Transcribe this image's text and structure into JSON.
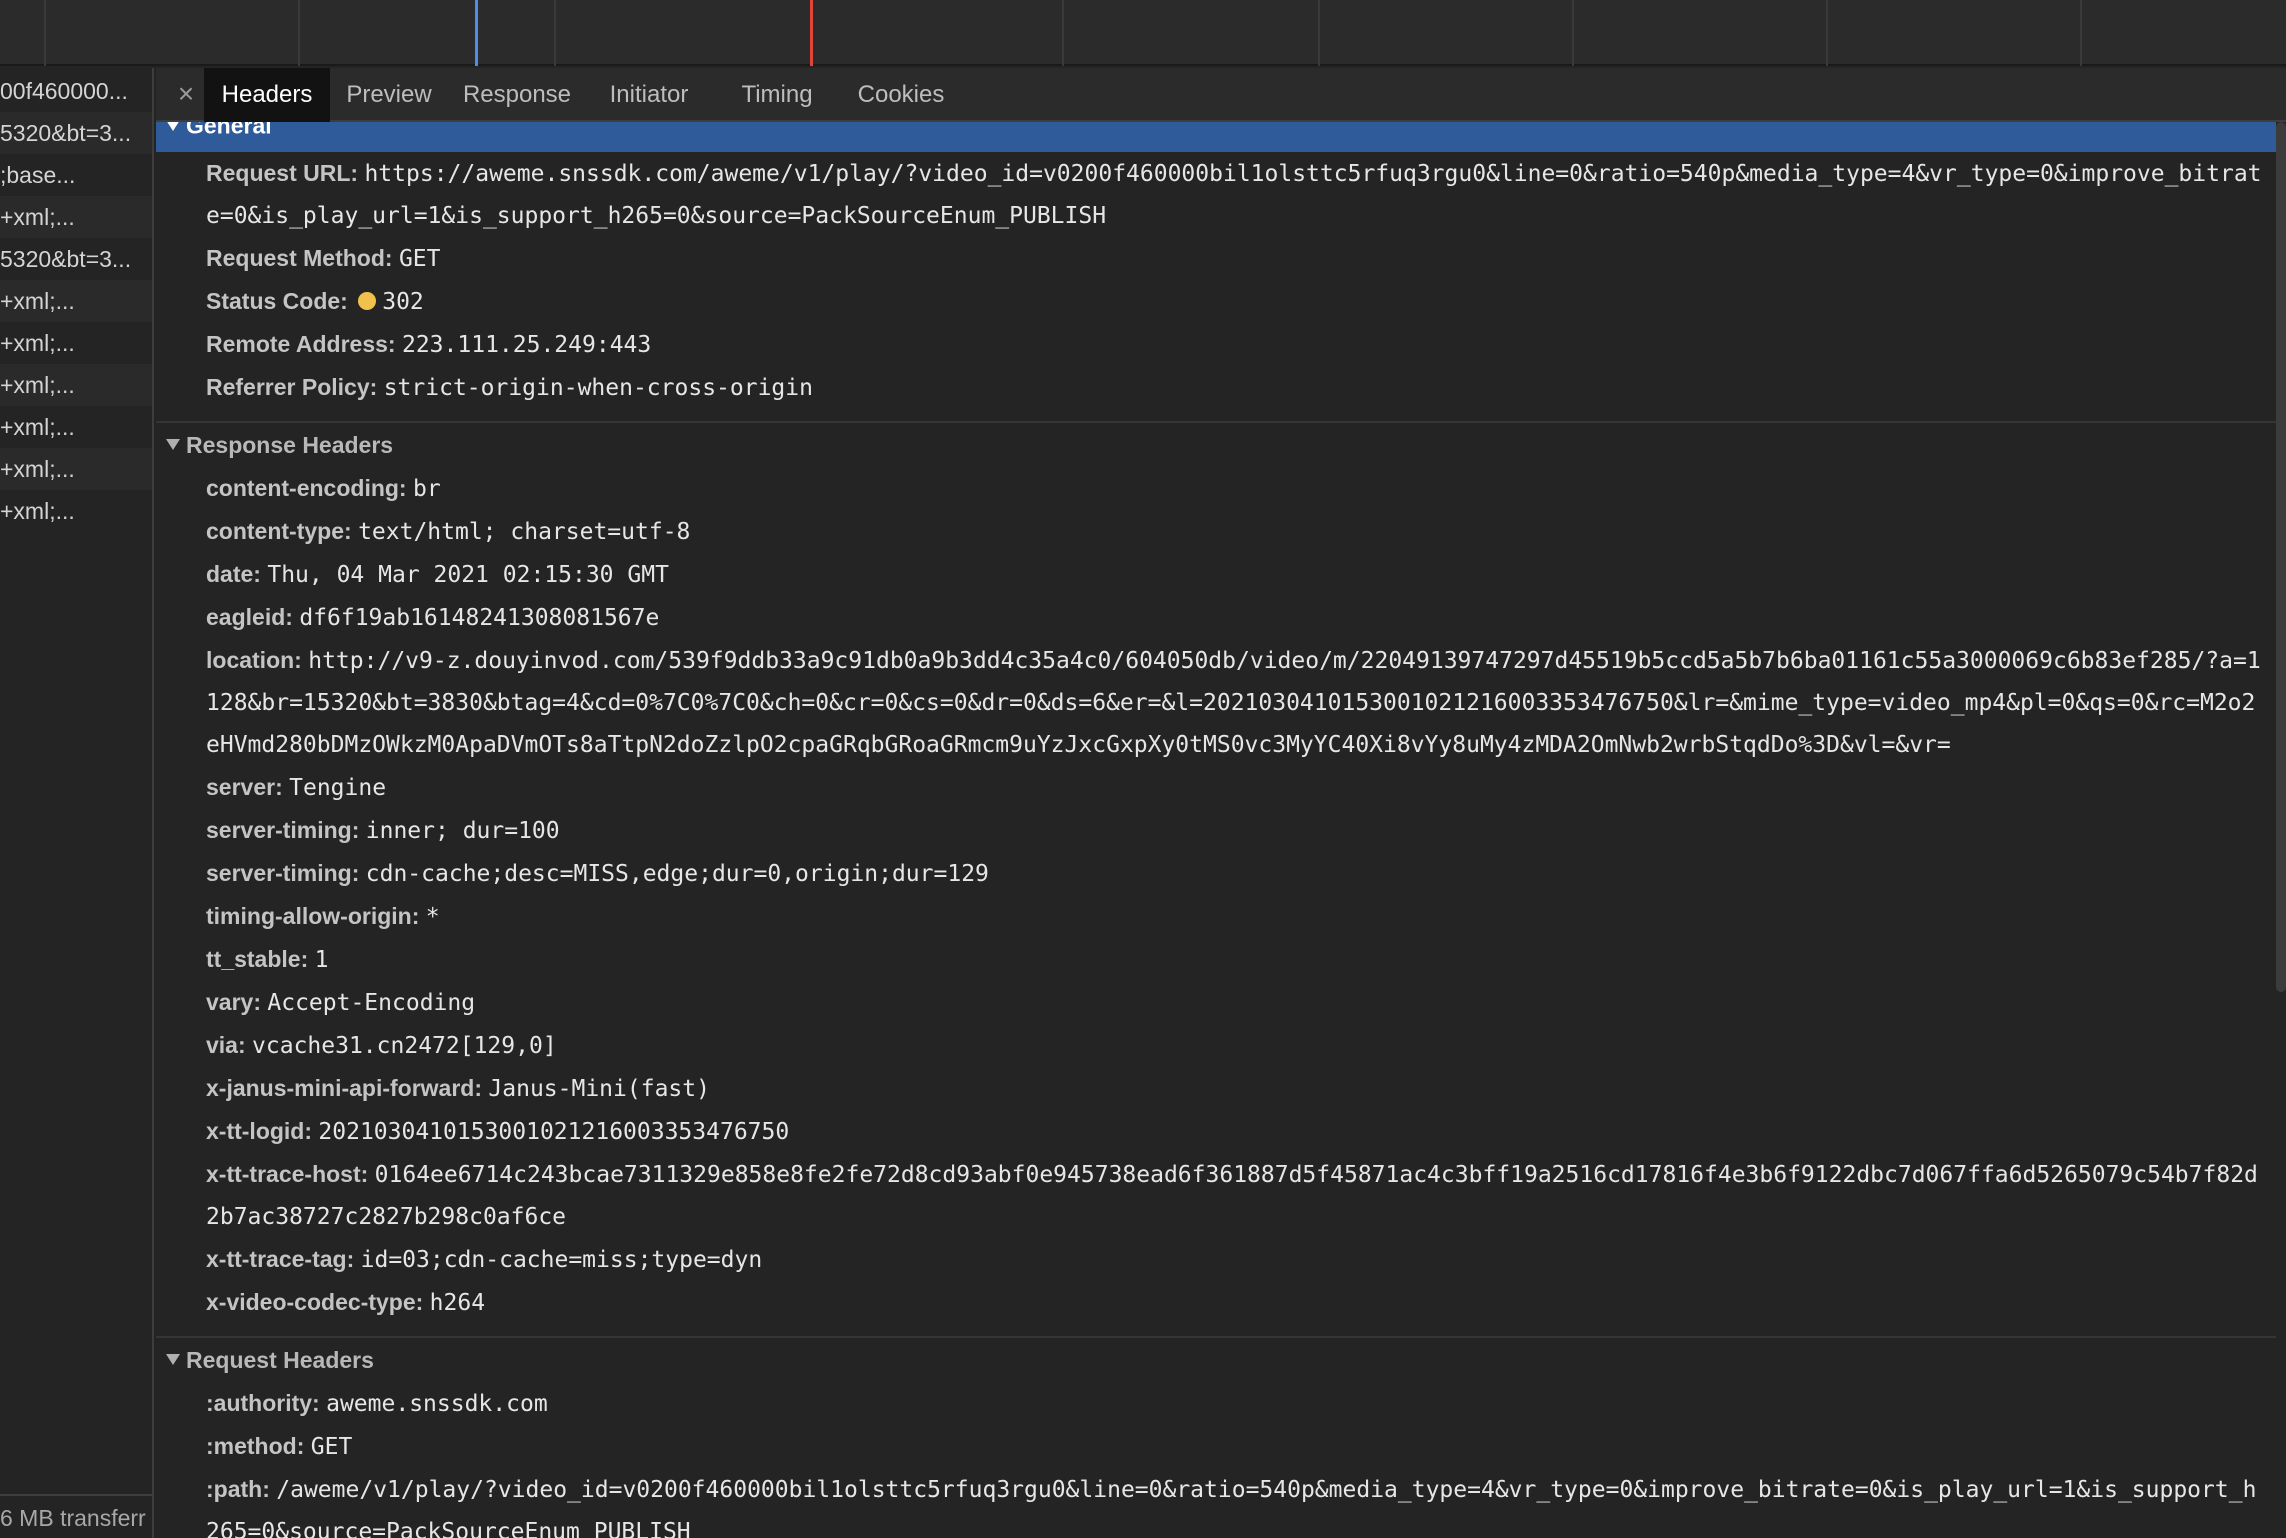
{
  "request_list": {
    "rows": [
      "00f460000...",
      "5320&bt=3...",
      ";base...",
      "+xml;...",
      "5320&bt=3...",
      "+xml;...",
      "+xml;...",
      "+xml;...",
      "+xml;...",
      "+xml;...",
      "+xml;..."
    ],
    "footer": "6 MB transferr"
  },
  "tabs": {
    "close": "×",
    "items": [
      "Headers",
      "Preview",
      "Response",
      "Initiator",
      "Timing",
      "Cookies"
    ],
    "active": "Headers"
  },
  "general": {
    "title": "General",
    "rows": [
      {
        "key": "Request URL:",
        "value": "https://aweme.snssdk.com/aweme/v1/play/?video_id=v0200f460000bil1olsttc5rfuq3rgu0&line=0&ratio=540p&media_type=4&vr_type=0&improve_bitrate=0&is_play_url=1&is_support_h265=0&source=PackSourceEnum_PUBLISH"
      },
      {
        "key": "Request Method:",
        "value": "GET"
      },
      {
        "key": "Status Code:",
        "value": "302",
        "status_color": "#f2c14b"
      },
      {
        "key": "Remote Address:",
        "value": "223.111.25.249:443"
      },
      {
        "key": "Referrer Policy:",
        "value": "strict-origin-when-cross-origin"
      }
    ]
  },
  "response_headers": {
    "title": "Response Headers",
    "rows": [
      {
        "key": "content-encoding:",
        "value": "br"
      },
      {
        "key": "content-type:",
        "value": "text/html; charset=utf-8"
      },
      {
        "key": "date:",
        "value": "Thu, 04 Mar 2021 02:15:30 GMT"
      },
      {
        "key": "eagleid:",
        "value": "df6f19ab16148241308081567e"
      },
      {
        "key": "location:",
        "value": "http://v9-z.douyinvod.com/539f9ddb33a9c91db0a9b3dd4c35a4c0/604050db/video/m/22049139747297d45519b5ccd5a5b7b6ba01161c55a3000069c6b83ef285/?a=1128&br=15320&bt=3830&btag=4&cd=0%7C0%7C0&ch=0&cr=0&cs=0&dr=0&ds=6&er=&l=2021030410153001021216003353476750&lr=&mime_type=video_mp4&pl=0&qs=0&rc=M2o2eHVmd280bDMzOWkzM0ApaDVmOTs8aTtpN2doZzlpO2cpaGRqbGRoaGRmcm9uYzJxcGxpXy0tMS0vc3MyYC40Xi8vYy8uMy4zMDA2OmNwb2wrbStqdDo%3D&vl=&vr="
      },
      {
        "key": "server:",
        "value": "Tengine"
      },
      {
        "key": "server-timing:",
        "value": "inner; dur=100"
      },
      {
        "key": "server-timing:",
        "value": "cdn-cache;desc=MISS,edge;dur=0,origin;dur=129"
      },
      {
        "key": "timing-allow-origin:",
        "value": "*"
      },
      {
        "key": "tt_stable:",
        "value": "1"
      },
      {
        "key": "vary:",
        "value": "Accept-Encoding"
      },
      {
        "key": "via:",
        "value": "vcache31.cn2472[129,0]"
      },
      {
        "key": "x-janus-mini-api-forward:",
        "value": "Janus-Mini(fast)"
      },
      {
        "key": "x-tt-logid:",
        "value": "2021030410153001021216003353476750"
      },
      {
        "key": "x-tt-trace-host:",
        "value": "0164ee6714c243bcae7311329e858e8fe2fe72d8cd93abf0e945738ead6f361887d5f45871ac4c3bff19a2516cd17816f4e3b6f9122dbc7d067ffa6d5265079c54b7f82d2b7ac38727c2827b298c0af6ce"
      },
      {
        "key": "x-tt-trace-tag:",
        "value": "id=03;cdn-cache=miss;type=dyn"
      },
      {
        "key": "x-video-codec-type:",
        "value": "h264"
      }
    ]
  },
  "request_headers": {
    "title": "Request Headers",
    "rows": [
      {
        "key": ":authority:",
        "value": "aweme.snssdk.com"
      },
      {
        "key": ":method:",
        "value": "GET"
      },
      {
        "key": ":path:",
        "value": "/aweme/v1/play/?video_id=v0200f460000bil1olsttc5rfuq3rgu0&line=0&ratio=540p&media_type=4&vr_type=0&improve_bitrate=0&is_play_url=1&is_support_h265=0&source=PackSourceEnum_PUBLISH"
      }
    ]
  },
  "colors": {
    "background": "#242424",
    "selected_section": "#2f5b9a",
    "timeline_blue": "#4a8ff0",
    "timeline_red": "#e0453c",
    "status_dot": "#f2c14b"
  }
}
